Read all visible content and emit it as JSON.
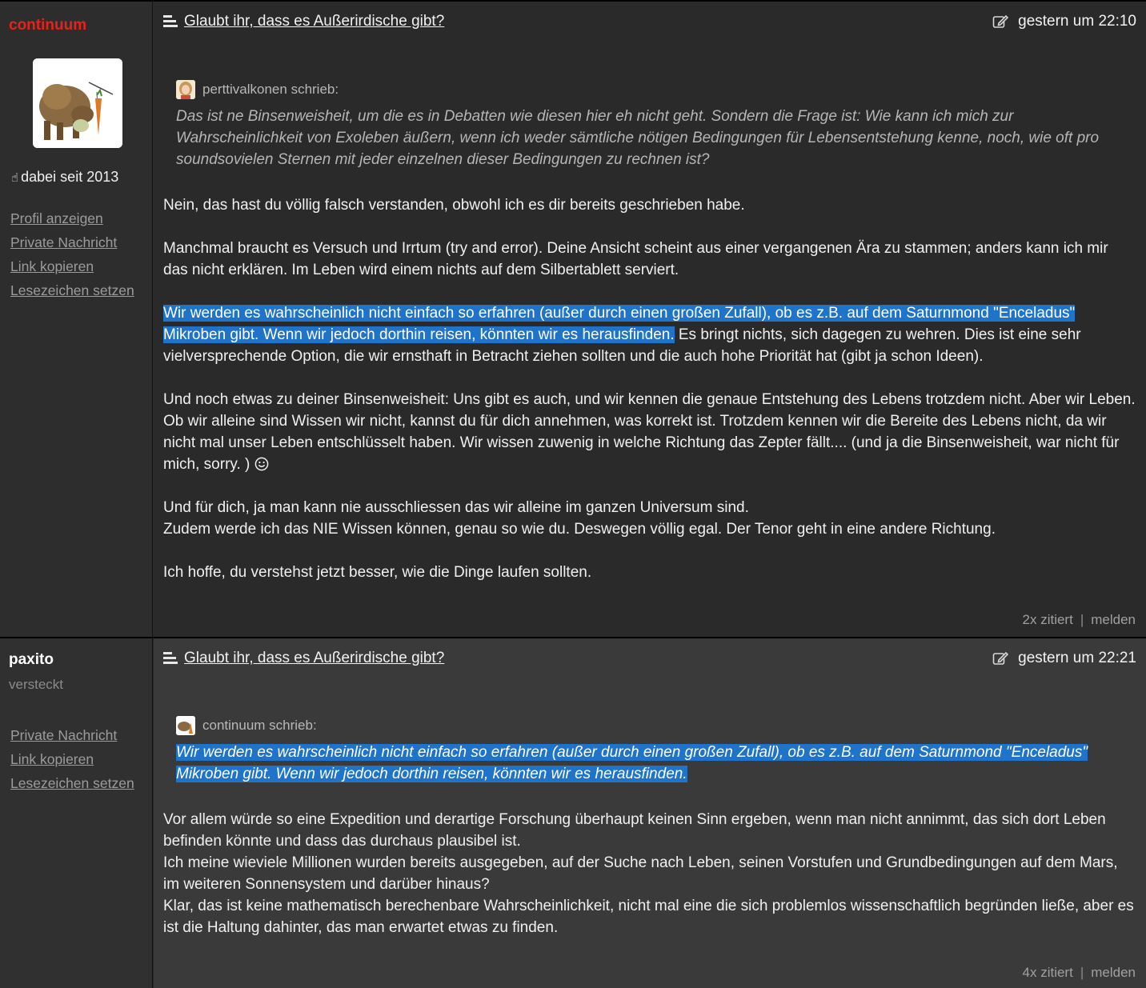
{
  "posts": [
    {
      "author": "continuum",
      "joined": "dabei seit 2013",
      "links": [
        "Profil anzeigen",
        "Private Nachricht",
        "Link kopieren",
        "Lesezeichen setzen"
      ],
      "topic": "Glaubt ihr, dass es Außerirdische gibt?",
      "timestamp": "gestern um 22:10",
      "quote": {
        "author": "perttivalkonen schrieb:",
        "text": "Das ist ne Binsenweisheit, um die es in Debatten wie diesen hier eh nicht geht. Sondern die Frage ist: Wie kann ich mich zur Wahrscheinlichkeit von Exoleben äußern, wenn ich weder sämtliche nötigen Bedingungen für Lebensentstehung kenne, noch, wie oft pro soundsovielen Sternen mit jeder einzelnen dieser Bedingungen zu rechnen ist?"
      },
      "p1": "Nein, das hast du völlig falsch verstanden, obwohl ich es dir bereits geschrieben habe.",
      "p2": "Manchmal braucht es Versuch und Irrtum (try and error). Deine Ansicht scheint aus einer vergangenen Ära zu stammen; anders kann ich mir das nicht erklären. Im Leben wird einem nichts auf dem Silbertablett serviert.",
      "p3_selected": "Wir werden es wahrscheinlich nicht einfach so erfahren (außer durch einen großen Zufall), ob es z.B. auf dem Saturnmond \"Enceladus\" Mikroben gibt. Wenn wir jedoch dorthin reisen, könnten wir es herausfinden.",
      "p3_rest": " Es bringt nichts, sich dagegen zu wehren. Dies ist eine sehr vielversprechende Option, die wir ernsthaft in Betracht ziehen sollten und die auch hohe Priorität hat (gibt ja schon Ideen).",
      "p4": "Und noch etwas zu deiner Binsenweisheit: Uns gibt es auch, und wir kennen die genaue Entstehung des Lebens trotzdem nicht. Aber wir Leben. Ob wir alleine sind Wissen wir nicht, kannst du für dich annehmen, was korrekt ist. Trotzdem kennen wir die Bereite des Lebens nicht, da wir nicht mal unser Leben entschlüsselt haben. Wir wissen zuwenig in welche Richtung das Zepter fällt.... (und ja die Binsenweisheit, war nicht für mich, sorry. )",
      "p5a": "Und für dich, ja man kann nie ausschliessen das wir alleine im ganzen Universum sind.",
      "p5b": "Zudem werde ich das NIE Wissen können, genau so wie du. Deswegen völlig egal. Der Tenor geht in eine andere Richtung.",
      "p6": "Ich hoffe, du verstehst jetzt besser, wie die Dinge laufen sollten.",
      "cited": "2x zitiert",
      "sep": "|",
      "report": "melden"
    },
    {
      "author": "paxito",
      "status": "versteckt",
      "links": [
        "Private Nachricht",
        "Link kopieren",
        "Lesezeichen setzen"
      ],
      "topic": "Glaubt ihr, dass es Außerirdische gibt?",
      "timestamp": "gestern um 22:21",
      "quote": {
        "author": "continuum schrieb:",
        "text": "Wir werden es wahrscheinlich nicht einfach so erfahren (außer durch einen großen Zufall), ob es z.B. auf dem Saturnmond \"Enceladus\" Mikroben gibt. Wenn wir jedoch dorthin reisen, könnten wir es herausfinden."
      },
      "l1": "Vor allem würde so eine Expedition und derartige Forschung überhaupt keinen Sinn ergeben, wenn man nicht annimmt, das sich dort Leben befinden könnte und dass das durchaus plausibel ist.",
      "l2": "Ich meine wieviele Millionen wurden bereits ausgegeben, auf der Suche nach Leben, seinen Vorstufen und Grundbedingungen auf dem Mars, im weiteren Sonnensystem und darüber hinaus?",
      "l3": "Klar, das ist keine mathematisch berechenbare Wahrscheinlichkeit, nicht mal eine die sich problemlos wissenschaftlich begründen ließe, aber es ist die Haltung dahinter, das man erwartet etwas zu finden.",
      "cited": "4x zitiert",
      "sep": "|",
      "report": "melden"
    }
  ],
  "colors": {
    "author_highlight": "#e8221a",
    "selection": "#1f73c8",
    "background": "#2b2b2b"
  },
  "icons": [
    "topic-icon",
    "edit-icon",
    "hand-icon",
    "smiley-icon"
  ]
}
